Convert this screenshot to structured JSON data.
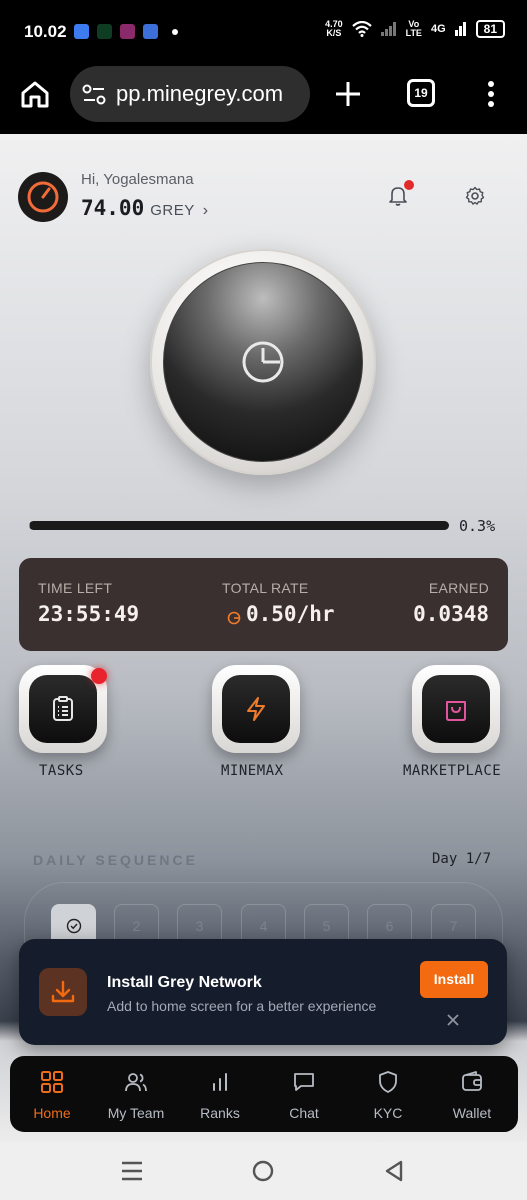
{
  "status_bar": {
    "time": "10.02",
    "net_speed_value": "4.70",
    "net_speed_unit": "K/S",
    "volte_line1": "Vo",
    "volte_line2": "LTE",
    "network": "4G",
    "battery": "81"
  },
  "browser": {
    "url": "pp.minegrey.com",
    "tab_count": "19"
  },
  "header": {
    "greeting": "Hi, Yogalesmana",
    "balance_value": "74.00",
    "balance_unit": "GREY"
  },
  "mining": {
    "progress_percent": 0.3,
    "progress_label": "0.3%"
  },
  "stats": {
    "time_left_label": "TIME LEFT",
    "time_left_value": "23:55:49",
    "total_rate_label": "TOTAL RATE",
    "total_rate_value": "0.50/hr",
    "earned_label": "EARNED",
    "earned_value": "0.0348"
  },
  "features": [
    {
      "label": "TASKS",
      "icon": "clipboard-icon",
      "has_notification": true
    },
    {
      "label": "MINEMAX",
      "icon": "lightning-icon",
      "has_notification": false
    },
    {
      "label": "MARKETPLACE",
      "icon": "shopping-bag-icon",
      "has_notification": false
    }
  ],
  "daily": {
    "title": "DAILY SEQUENCE",
    "day_label": "Day 1/7",
    "days": [
      "1",
      "2",
      "3",
      "4",
      "5",
      "6",
      "7"
    ],
    "completed_days": 1
  },
  "install_banner": {
    "title": "Install Grey Network",
    "subtitle": "Add to home screen for a better experience",
    "button_label": "Install"
  },
  "bottom_nav": [
    {
      "label": "Home",
      "icon": "grid-icon",
      "active": true
    },
    {
      "label": "My Team",
      "icon": "users-icon",
      "active": false
    },
    {
      "label": "Ranks",
      "icon": "bar-chart-icon",
      "active": false
    },
    {
      "label": "Chat",
      "icon": "chat-icon",
      "active": false
    },
    {
      "label": "KYC",
      "icon": "shield-icon",
      "active": false
    },
    {
      "label": "Wallet",
      "icon": "wallet-icon",
      "active": false
    }
  ],
  "colors": {
    "accent": "#f36a10",
    "stats_card": "#3a302f",
    "banner_bg": "#151c2b",
    "nav_bg": "#0b0b0c",
    "notification": "#e8232d",
    "marketplace_icon": "#e2559c"
  }
}
